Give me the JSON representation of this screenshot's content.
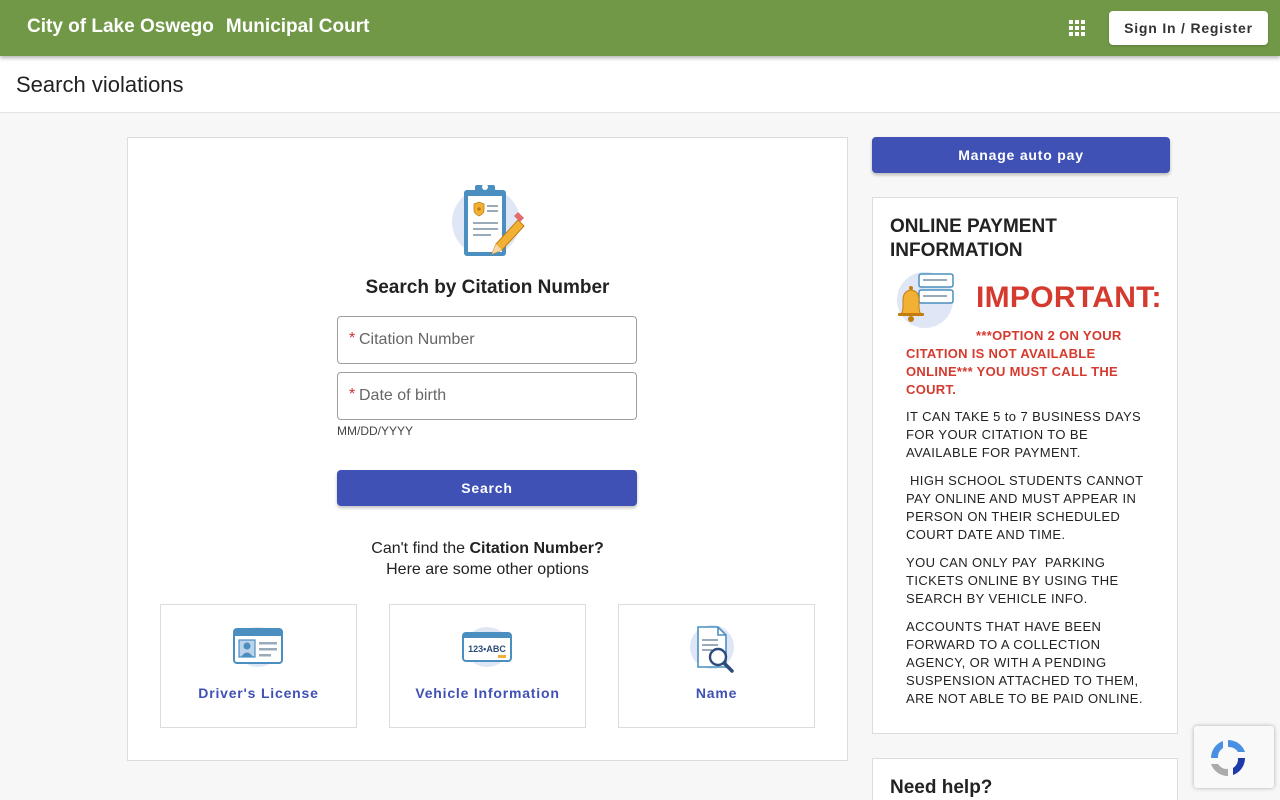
{
  "header": {
    "brand": "City of Lake Oswego",
    "court": "Municipal Court",
    "apps_icon": "apps-grid-icon",
    "signin_label": "Sign In / Register"
  },
  "page": {
    "title": "Search violations"
  },
  "search": {
    "heading": "Search by Citation Number",
    "citation_placeholder": "Citation Number",
    "dob_placeholder": "Date of birth",
    "required_mark": "*",
    "dob_hint": "MM/DD/YYYY",
    "button_label": "Search",
    "cant_find_prefix": "Can't find the ",
    "cant_find_bold": "Citation Number?",
    "other_options": "Here are some other options"
  },
  "options": [
    {
      "label": "Driver's License",
      "icon": "id-card-icon"
    },
    {
      "label": "Vehicle Information",
      "icon": "license-plate-icon"
    },
    {
      "label": "Name",
      "icon": "document-search-icon"
    }
  ],
  "sidebar": {
    "autopay_label": "Manage auto pay",
    "info_title": "ONLINE PAYMENT INFORMATION",
    "important": "IMPORTANT:",
    "option_note": "***OPTION 2 ON YOUR CITATION IS NOT AVAILABLE ONLINE*** YOU MUST CALL THE COURT.",
    "paragraphs": [
      "IT CAN TAKE 5 to 7 BUSINESS DAYS FOR YOUR CITATION TO BE AVAILABLE FOR PAYMENT.",
      " HIGH SCHOOL STUDENTS CANNOT PAY ONLINE AND MUST APPEAR IN PERSON ON THEIR SCHEDULED COURT DATE AND TIME.",
      "YOU CAN ONLY PAY  PARKING TICKETS ONLINE BY USING THE SEARCH BY VEHICLE INFO.",
      "ACCOUNTS THAT HAVE BEEN FORWARD TO A COLLECTION AGENCY, OR WITH A PENDING SUSPENSION ATTACHED TO THEM, ARE NOT ABLE TO BE PAID ONLINE."
    ],
    "help_title": "Need help?"
  },
  "plate_text": "123•ABC",
  "colors": {
    "header_green": "#709847",
    "primary_blue": "#3f51b5",
    "alert_red": "#d53a2e"
  }
}
